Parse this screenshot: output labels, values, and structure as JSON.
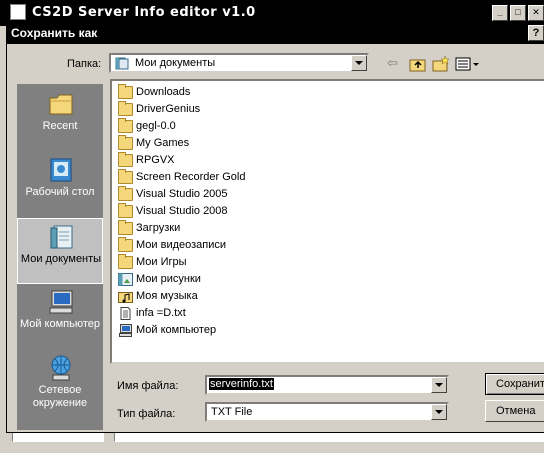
{
  "background_window": {
    "title": "CS2D Server Info editor v1.0",
    "minimize": "_",
    "maximize": "□",
    "close": "✕"
  },
  "dialog": {
    "title": "Сохранить как",
    "help": "?",
    "lookin_label": "Папка:",
    "lookin_value": "Мои документы",
    "back_glyph": "⇦",
    "places": [
      {
        "label": "Recent",
        "icon": "recent-folder-icon"
      },
      {
        "label": "Рабочий стол",
        "icon": "desktop-icon"
      },
      {
        "label": "Мои документы",
        "icon": "my-documents-icon"
      },
      {
        "label": "Мой компьютер",
        "icon": "my-computer-icon"
      },
      {
        "label": "Сетевое окружение",
        "icon": "network-icon"
      }
    ],
    "files": [
      {
        "name": "Downloads",
        "type": "folder"
      },
      {
        "name": "DriverGenius",
        "type": "folder"
      },
      {
        "name": "gegl-0.0",
        "type": "folder"
      },
      {
        "name": "My Games",
        "type": "folder"
      },
      {
        "name": "RPGVX",
        "type": "folder"
      },
      {
        "name": "Screen Recorder Gold",
        "type": "folder"
      },
      {
        "name": "Visual Studio 2005",
        "type": "folder"
      },
      {
        "name": "Visual Studio 2008",
        "type": "folder"
      },
      {
        "name": "Загрузки",
        "type": "folder"
      },
      {
        "name": "Мои видеозаписи",
        "type": "folder"
      },
      {
        "name": "Мои Игры",
        "type": "folder"
      },
      {
        "name": "Мои рисунки",
        "type": "pictures"
      },
      {
        "name": "Моя музыка",
        "type": "music"
      },
      {
        "name": "infa =D.txt",
        "type": "text"
      },
      {
        "name": "Мой компьютер",
        "type": "computer"
      }
    ],
    "filename_label": "Имя файла:",
    "filename_value": "serverinfo.txt",
    "filetype_label": "Тип файла:",
    "filetype_value": "TXT File",
    "save_button": "Сохранить",
    "cancel_button": "Отмена"
  }
}
